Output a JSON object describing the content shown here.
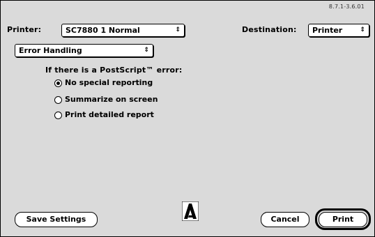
{
  "dialog": {
    "version": "8.7.1-3.6.01"
  },
  "printer": {
    "label": "Printer:",
    "value": "SC7880 1 Normal",
    "arrow": "⇕"
  },
  "destination": {
    "label": "Destination:",
    "value": "Printer",
    "arrow": "⇕"
  },
  "panel": {
    "value": "Error Handling",
    "arrow": "⇕"
  },
  "error_section": {
    "heading": "If there is a PostScript™ error:",
    "options": [
      {
        "label": "No special reporting",
        "selected": true
      },
      {
        "label": "Summarize on screen",
        "selected": false
      },
      {
        "label": "Print detailed report",
        "selected": false
      }
    ]
  },
  "buttons": {
    "save_settings": "Save Settings",
    "cancel": "Cancel",
    "print": "Print"
  },
  "logo": {
    "icon": "adobe-logo-icon"
  }
}
